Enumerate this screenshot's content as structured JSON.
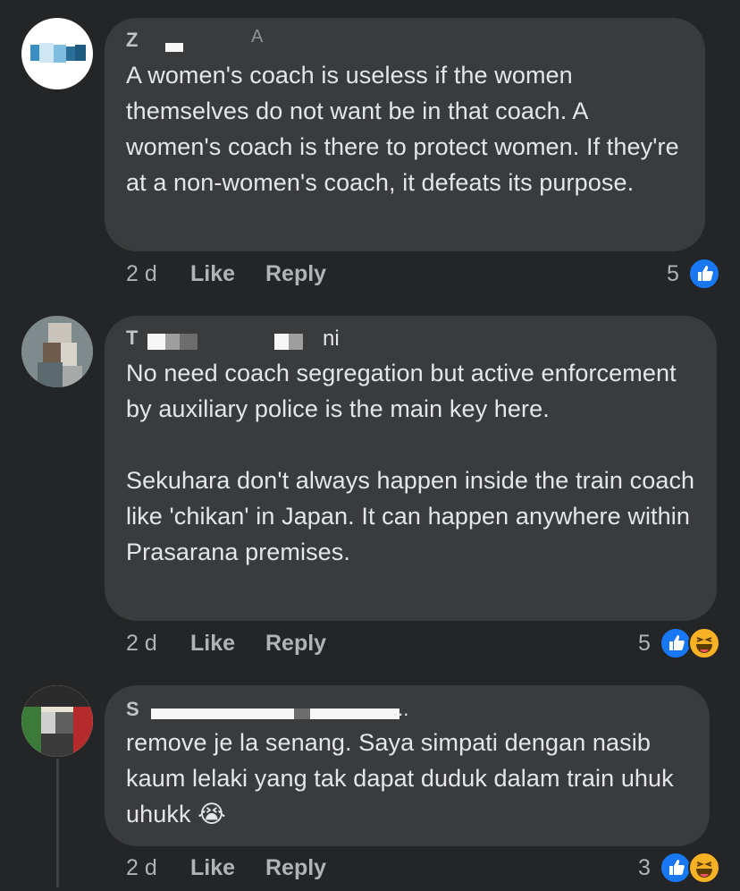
{
  "comments": [
    {
      "author_initial": "Z",
      "author_blur": "A",
      "text": "A women's coach is useless if the women themselves do not want be in that coach. A women's coach is there to protect women. If they're at a non-women's coach, it defeats its purpose.",
      "time": "2 d",
      "like_label": "Like",
      "reply_label": "Reply",
      "reaction_count": "5",
      "reactions": [
        "like-icon"
      ]
    },
    {
      "author_initial": "T",
      "author_blur": "ni",
      "text": "No need coach segregation but active enforcement by auxiliary police is the main key here.\n\nSekuhara don't always happen inside the train coach like 'chikan' in Japan. It can happen anywhere within Prasarana premises.",
      "time": "2 d",
      "like_label": "Like",
      "reply_label": "Reply",
      "reaction_count": "5",
      "reactions": [
        "like-icon",
        "haha-icon"
      ]
    },
    {
      "author_initial": "S",
      "author_blur": "...",
      "text": "remove je la senang. Saya simpati dengan nasib kaum lelaki yang tak dapat duduk dalam train uhuk uhukk 😭",
      "time": "2 d",
      "like_label": "Like",
      "reply_label": "Reply",
      "reaction_count": "3",
      "reactions": [
        "like-icon",
        "haha-icon"
      ]
    }
  ],
  "colors": {
    "background": "#242526",
    "bubble": "#3a3b3c",
    "text": "#e4e6eb",
    "secondary": "#b0b3b8",
    "like_blue": "#1877f2",
    "haha_yellow": "#f7b125"
  }
}
